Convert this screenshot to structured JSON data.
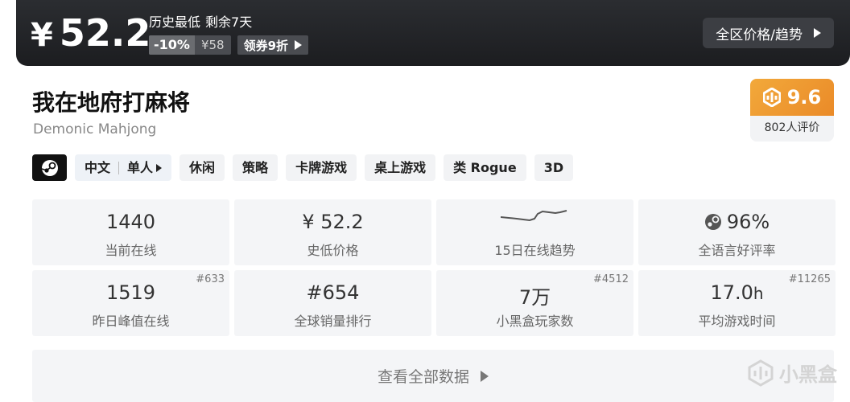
{
  "price_banner": {
    "currency_symbol": "¥",
    "price": "52.2",
    "lowest_label": "历史最低",
    "remaining": "剩余7天",
    "discount": "-10%",
    "original_price": "¥58",
    "coupon_label": "领券9折",
    "region_button": "全区价格/趋势"
  },
  "game": {
    "title": "我在地府打麻将",
    "subtitle": "Demonic Mahjong"
  },
  "score": {
    "value": "9.6",
    "reviews": "802人评价"
  },
  "tags": {
    "language": "中文",
    "mode": "单人",
    "list": [
      "休闲",
      "策略",
      "卡牌游戏",
      "桌上游戏",
      "类 Rogue",
      "3D"
    ]
  },
  "stats": [
    {
      "value": "1440",
      "label": "当前在线",
      "rank": ""
    },
    {
      "value": "¥ 52.2",
      "label": "史低价格",
      "rank": ""
    },
    {
      "value": "",
      "label": "15日在线趋势",
      "rank": ""
    },
    {
      "value": "96%",
      "label": "全语言好评率",
      "rank": ""
    },
    {
      "value": "1519",
      "label": "昨日峰值在线",
      "rank": "#633"
    },
    {
      "value": "#654",
      "label": "全球销量排行",
      "rank": ""
    },
    {
      "value": "7万",
      "label": "小黑盒玩家数",
      "rank": "#4512"
    },
    {
      "value": "17.0",
      "unit": "h",
      "label": "平均游戏时间",
      "rank": "#11265"
    }
  ],
  "more_button": "查看全部数据",
  "watermark": "小黑盒",
  "colors": {
    "banner": "#1f2023",
    "score_orange": "#ee9a31",
    "card_bg": "#f4f5f7"
  }
}
